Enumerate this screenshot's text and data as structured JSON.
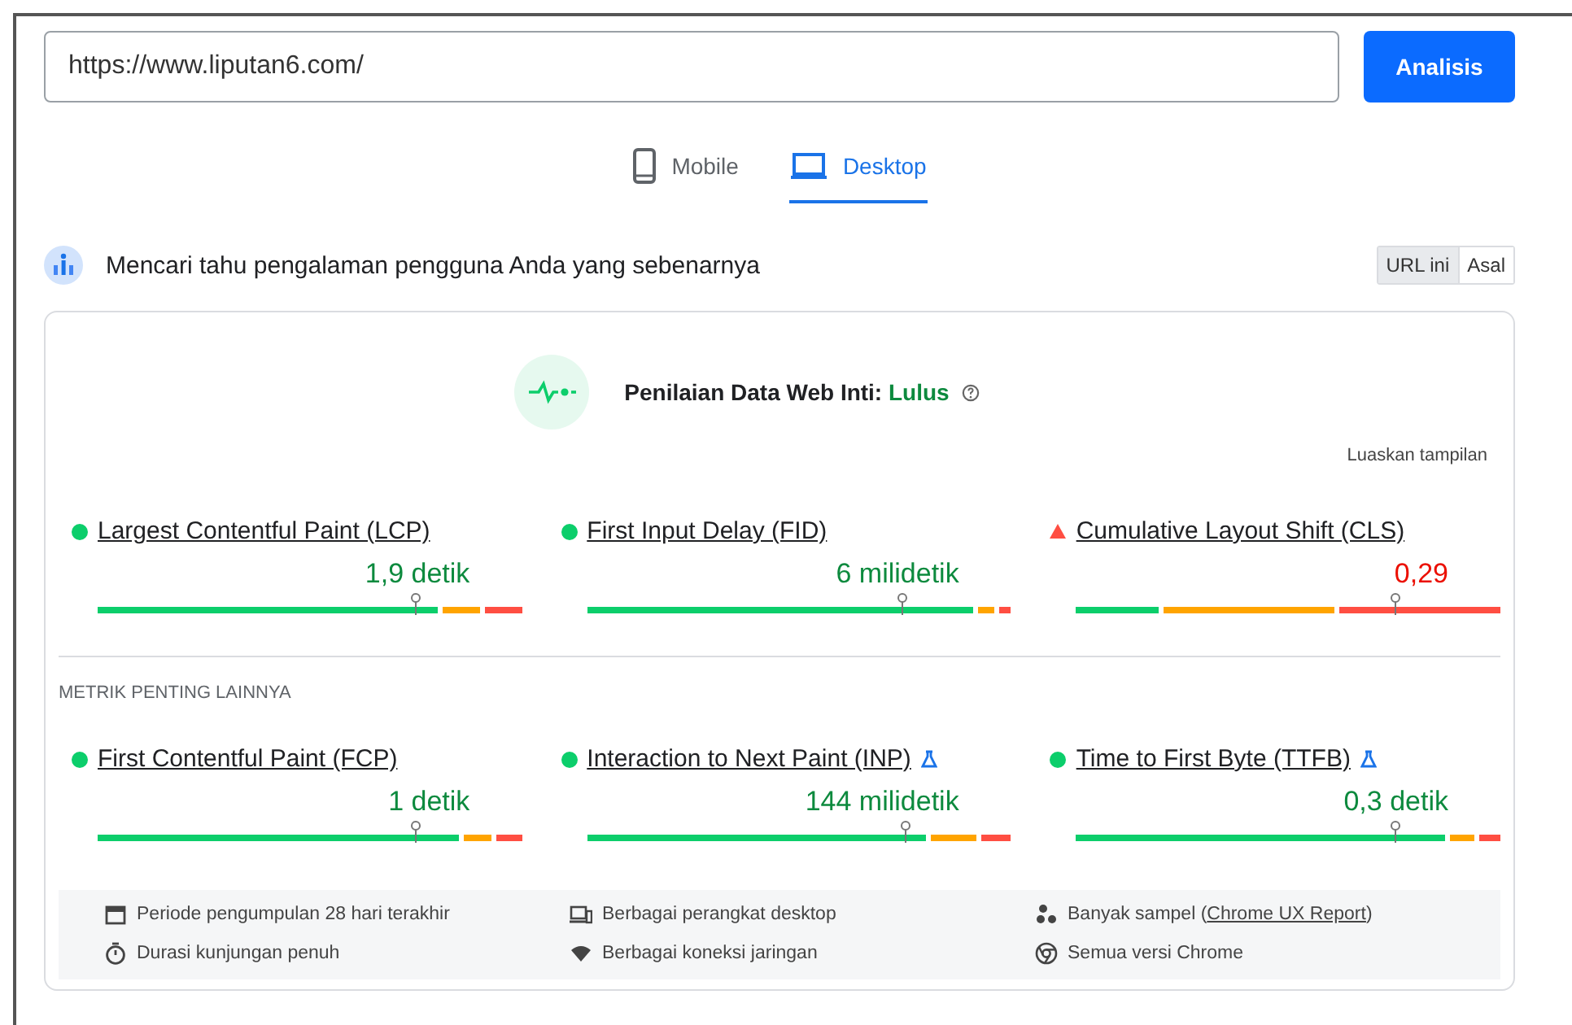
{
  "url_field": {
    "value": "https://www.liputan6.com/"
  },
  "analyze_button": "Analisis",
  "tabs": [
    {
      "label": "Mobile",
      "kind": "phone",
      "selected": false
    },
    {
      "label": "Desktop",
      "kind": "laptop",
      "selected": true
    }
  ],
  "section_title": "Mencari tahu pengalaman pengguna Anda yang sebenarnya",
  "scope_toggle": [
    {
      "label": "URL ini",
      "selected": true
    },
    {
      "label": "Asal",
      "selected": false
    }
  ],
  "assessment": {
    "label": "Penilaian Data Web Inti:",
    "result": "Lulus",
    "passed": true
  },
  "expand_link": "Luaskan tampilan",
  "core_metrics": [
    {
      "name": "Largest Contentful Paint (LCP)",
      "passed": true,
      "experimental": false,
      "value": "1,9 detik",
      "level": 0.75
    },
    {
      "name": "First Input Delay (FID)",
      "passed": true,
      "experimental": false,
      "value": "6 milidetik",
      "level": 0.74
    },
    {
      "name": "Cumulative Layout Shift (CLS)",
      "passed": false,
      "experimental": false,
      "value": "0,29",
      "level": 0.75
    }
  ],
  "other_label": "METRIK PENTING LAINNYA",
  "other_metrics": [
    {
      "name": "First Contentful Paint (FCP)",
      "passed": true,
      "experimental": false,
      "value": "1 detik",
      "level": 0.75
    },
    {
      "name": "Interaction to Next Paint (INP)",
      "passed": true,
      "experimental": true,
      "value": "144 milidetik",
      "level": 0.75
    },
    {
      "name": "Time to First Byte (TTFB)",
      "passed": true,
      "experimental": true,
      "value": "0,3 detik",
      "level": 0.75
    }
  ],
  "footer_notes": [
    {
      "kind": "calendar",
      "text": "Periode pengumpulan 28 hari terakhir"
    },
    {
      "kind": "devices",
      "text": "Berbagai perangkat desktop"
    },
    {
      "kind": "samples",
      "text": "Banyak sampel (",
      "link": "Chrome UX Report",
      "after": ")"
    },
    {
      "kind": "timer",
      "text": "Durasi kunjungan penuh"
    },
    {
      "kind": "wifi",
      "text": "Berbagai koneksi jaringan"
    },
    {
      "kind": "chrome",
      "text": "Semua versi Chrome"
    }
  ]
}
